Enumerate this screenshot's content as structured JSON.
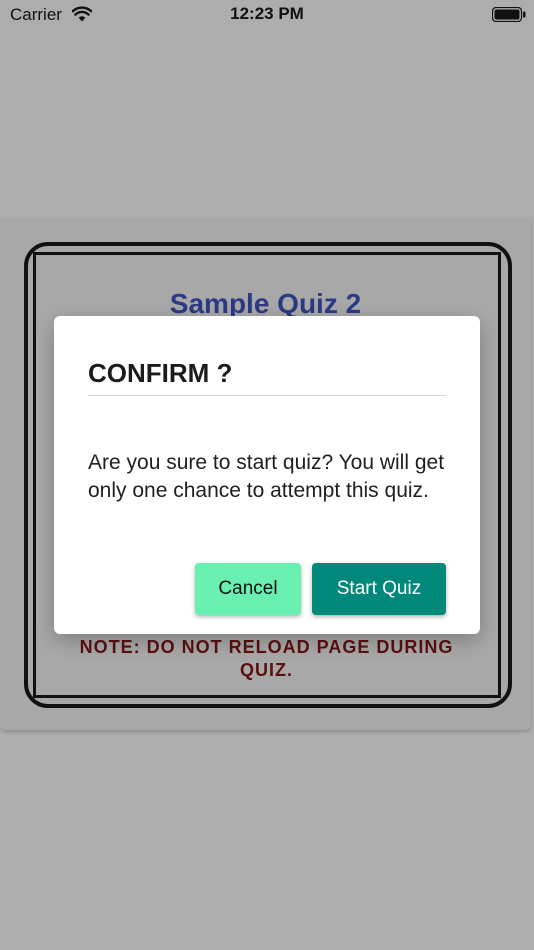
{
  "status_bar": {
    "carrier": "Carrier",
    "time": "12:23 PM",
    "icons": [
      "wifi-icon",
      "battery-icon"
    ]
  },
  "background_page": {
    "quiz_title": "Sample Quiz 2",
    "note": "NOTE: DO NOT RELOAD PAGE DURING QUIZ."
  },
  "dialog": {
    "title": "CONFIRM ?",
    "message": "Are you sure to start quiz? You will get only one chance to attempt this quiz.",
    "cancel_label": "Cancel",
    "start_label": "Start Quiz"
  },
  "colors": {
    "overlay": "#adadad",
    "cancel_button": "#69f0b0",
    "start_button": "#00897b",
    "title_text": "#2c3a85",
    "note_text": "#5c0f0f"
  }
}
